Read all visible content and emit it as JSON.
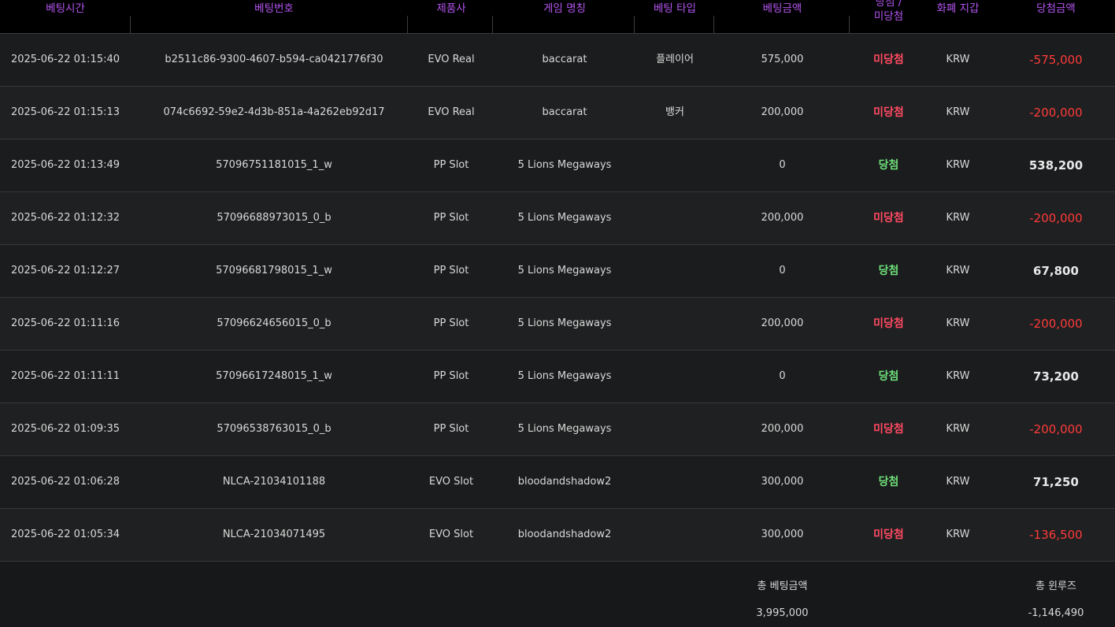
{
  "columns": {
    "time": "베팅시간",
    "bet_id": "베팅번호",
    "provider": "제품사",
    "game": "게임 명칭",
    "bet_type": "베팅 타입",
    "bet_amount": "베팅금액",
    "result_line1": "당첨 /",
    "result_line2": "미당첨",
    "wallet": "화폐 지갑",
    "win_amount": "당첨금액"
  },
  "rows": [
    {
      "time": "2025-06-22 01:15:40",
      "bet_id": "b2511c86-9300-4607-b594-ca0421776f30",
      "provider": "EVO Real",
      "game": "baccarat",
      "bet_type": "플레이어",
      "bet_amount": "575,000",
      "result": "미당첨",
      "result_status": "lose",
      "wallet": "KRW",
      "win_amount": "-575,000"
    },
    {
      "time": "2025-06-22 01:15:13",
      "bet_id": "074c6692-59e2-4d3b-851a-4a262eb92d17",
      "provider": "EVO Real",
      "game": "baccarat",
      "bet_type": "뱅커",
      "bet_amount": "200,000",
      "result": "미당첨",
      "result_status": "lose",
      "wallet": "KRW",
      "win_amount": "-200,000"
    },
    {
      "time": "2025-06-22 01:13:49",
      "bet_id": "57096751181015_1_w",
      "provider": "PP Slot",
      "game": "5 Lions Megaways",
      "bet_type": "",
      "bet_amount": "0",
      "result": "당첨",
      "result_status": "win",
      "wallet": "KRW",
      "win_amount": "538,200"
    },
    {
      "time": "2025-06-22 01:12:32",
      "bet_id": "57096688973015_0_b",
      "provider": "PP Slot",
      "game": "5 Lions Megaways",
      "bet_type": "",
      "bet_amount": "200,000",
      "result": "미당첨",
      "result_status": "lose",
      "wallet": "KRW",
      "win_amount": "-200,000"
    },
    {
      "time": "2025-06-22 01:12:27",
      "bet_id": "57096681798015_1_w",
      "provider": "PP Slot",
      "game": "5 Lions Megaways",
      "bet_type": "",
      "bet_amount": "0",
      "result": "당첨",
      "result_status": "win",
      "wallet": "KRW",
      "win_amount": "67,800"
    },
    {
      "time": "2025-06-22 01:11:16",
      "bet_id": "57096624656015_0_b",
      "provider": "PP Slot",
      "game": "5 Lions Megaways",
      "bet_type": "",
      "bet_amount": "200,000",
      "result": "미당첨",
      "result_status": "lose",
      "wallet": "KRW",
      "win_amount": "-200,000"
    },
    {
      "time": "2025-06-22 01:11:11",
      "bet_id": "57096617248015_1_w",
      "provider": "PP Slot",
      "game": "5 Lions Megaways",
      "bet_type": "",
      "bet_amount": "0",
      "result": "당첨",
      "result_status": "win",
      "wallet": "KRW",
      "win_amount": "73,200"
    },
    {
      "time": "2025-06-22 01:09:35",
      "bet_id": "57096538763015_0_b",
      "provider": "PP Slot",
      "game": "5 Lions Megaways",
      "bet_type": "",
      "bet_amount": "200,000",
      "result": "미당첨",
      "result_status": "lose",
      "wallet": "KRW",
      "win_amount": "-200,000"
    },
    {
      "time": "2025-06-22 01:06:28",
      "bet_id": "NLCA-21034101188",
      "provider": "EVO Slot",
      "game": "bloodandshadow2",
      "bet_type": "",
      "bet_amount": "300,000",
      "result": "당첨",
      "result_status": "win",
      "wallet": "KRW",
      "win_amount": "71,250"
    },
    {
      "time": "2025-06-22 01:05:34",
      "bet_id": "NLCA-21034071495",
      "provider": "EVO Slot",
      "game": "bloodandshadow2",
      "bet_type": "",
      "bet_amount": "300,000",
      "result": "미당첨",
      "result_status": "lose",
      "wallet": "KRW",
      "win_amount": "-136,500"
    }
  ],
  "footer": {
    "total_bet_label": "총 베팅금액",
    "total_bet_value": "3,995,000",
    "total_winloss_label": "총 윈루즈",
    "total_winloss_value": "-1,146,490"
  },
  "colors": {
    "header_text": "#b455f0",
    "lose": "#ff4a62",
    "win": "#6fe07a",
    "negative_amount": "#ff3b3b"
  }
}
